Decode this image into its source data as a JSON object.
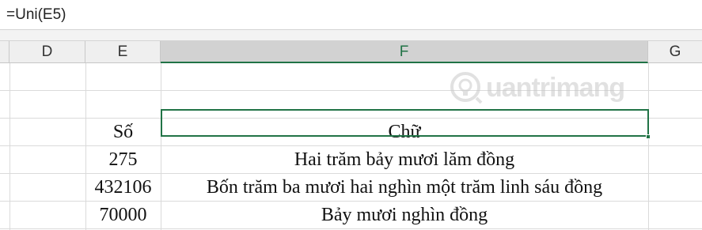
{
  "formula_bar": {
    "text": "=Uni(E5)"
  },
  "columns": [
    "D",
    "E",
    "F",
    "G"
  ],
  "selected_column": "F",
  "watermark": {
    "text": "uantrimang"
  },
  "rows": [
    {
      "E": "",
      "F": ""
    },
    {
      "E": "",
      "F": ""
    },
    {
      "E": "Số",
      "F": "Chữ"
    },
    {
      "E": "275",
      "F": "Hai trăm bảy mươi lăm đồng"
    },
    {
      "E": "432106",
      "F": "Bốn trăm ba mươi hai nghìn một trăm linh sáu đồng"
    },
    {
      "E": "70000",
      "F": "Bảy mươi nghìn đồng"
    }
  ],
  "colors": {
    "accent": "#217346",
    "gridline": "#dadada",
    "header_bg": "#efefef"
  }
}
